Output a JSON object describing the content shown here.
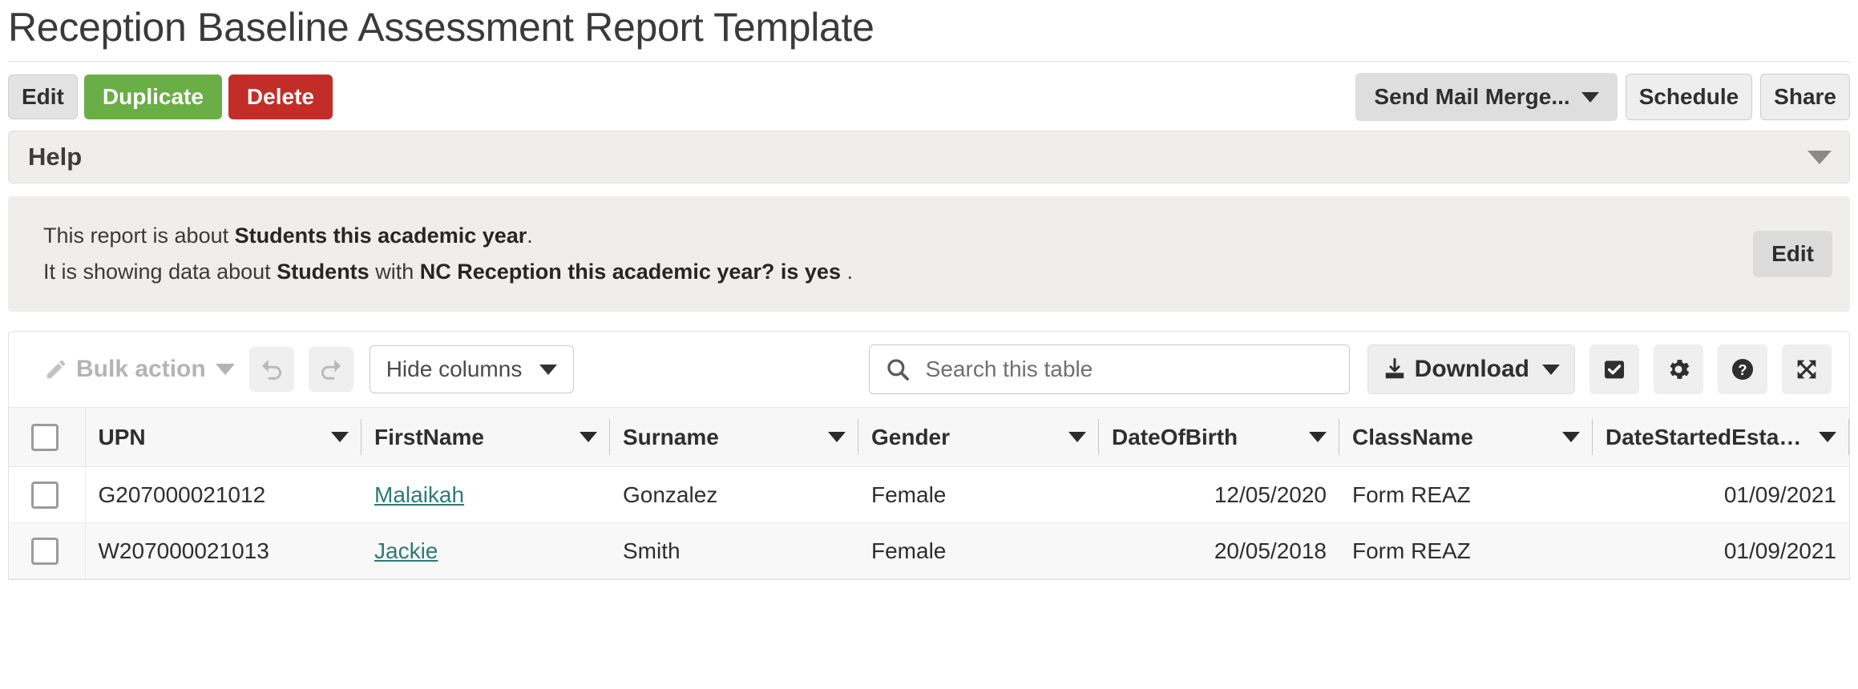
{
  "page": {
    "title": "Reception Baseline Assessment Report Template"
  },
  "action_bar": {
    "edit_label": "Edit",
    "duplicate_label": "Duplicate",
    "delete_label": "Delete",
    "send_mail_merge_label": "Send Mail Merge...",
    "schedule_label": "Schedule",
    "share_label": "Share"
  },
  "help_panel": {
    "label": "Help",
    "chevron": "chevron-down-icon"
  },
  "info_panel": {
    "line1_prefix": "This report is about ",
    "line1_bold": "Students this academic year",
    "line1_suffix": ".",
    "line2_prefix": "It is showing data about ",
    "line2_bold1": "Students",
    "line2_mid": " with ",
    "line2_bold2": "NC Reception this academic year? is yes",
    "line2_suffix": " .",
    "edit_label": "Edit"
  },
  "table_toolbar": {
    "bulk_action_label": "Bulk action",
    "undo_icon": "undo-icon",
    "redo_icon": "redo-icon",
    "hide_columns_label": "Hide columns",
    "search_placeholder": "Search this table",
    "search_value": "",
    "download_label": "Download",
    "select_icon": "checkbox-checked-icon",
    "settings_icon": "gear-icon",
    "help_icon": "question-circle-icon",
    "fullscreen_icon": "expand-arrows-icon"
  },
  "table": {
    "columns": [
      {
        "label": "UPN",
        "align": "left"
      },
      {
        "label": "FirstName",
        "align": "left"
      },
      {
        "label": "Surname",
        "align": "left"
      },
      {
        "label": "Gender",
        "align": "left"
      },
      {
        "label": "DateOfBirth",
        "align": "right"
      },
      {
        "label": "ClassName",
        "align": "left"
      },
      {
        "label": "DateStartedEstabli...",
        "align": "right"
      }
    ],
    "rows": [
      {
        "upn": "G207000021012",
        "firstname": "Malaikah",
        "surname": "Gonzalez",
        "gender": "Female",
        "dateofbirth": "12/05/2020",
        "classname": "Form REAZ",
        "datestarted": "01/09/2021"
      },
      {
        "upn": "W207000021013",
        "firstname": "Jackie",
        "surname": "Smith",
        "gender": "Female",
        "dateofbirth": "20/05/2018",
        "classname": "Form REAZ",
        "datestarted": "01/09/2021"
      }
    ]
  },
  "colors": {
    "green": "#6aaf45",
    "red": "#c32d28",
    "link": "#2b7a78",
    "panel_bg": "#efeeec"
  }
}
